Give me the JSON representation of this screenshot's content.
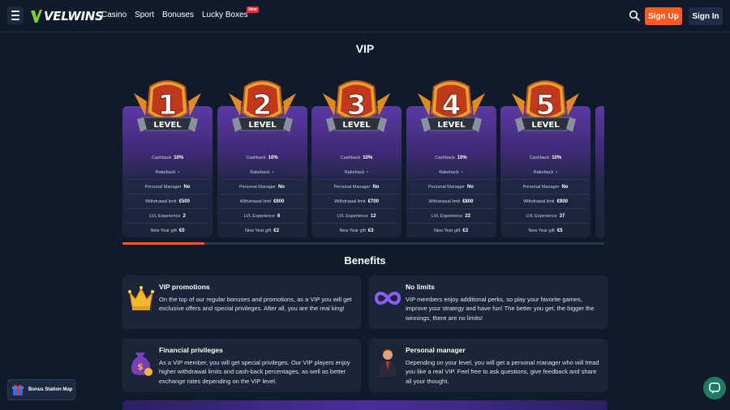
{
  "header": {
    "logo_text": "VELWINS",
    "nav": [
      {
        "label": "Casino"
      },
      {
        "label": "Sport"
      },
      {
        "label": "Bonuses"
      },
      {
        "label": "Lucky Boxes",
        "badge": "New"
      }
    ],
    "signup_label": "Sign Up",
    "signin_label": "Sign In"
  },
  "page_title": "VIP",
  "levels": [
    {
      "number": "1",
      "badge_word": "LEVEL",
      "cashback": "10%",
      "rakeback": "-",
      "manager": "No",
      "withdrawal": "€500",
      "experience": "2",
      "gift": "€0"
    },
    {
      "number": "2",
      "badge_word": "LEVEL",
      "cashback": "10%",
      "rakeback": "-",
      "manager": "No",
      "withdrawal": "€600",
      "experience": "6",
      "gift": "€2"
    },
    {
      "number": "3",
      "badge_word": "LEVEL",
      "cashback": "10%",
      "rakeback": "-",
      "manager": "No",
      "withdrawal": "€700",
      "experience": "12",
      "gift": "€3"
    },
    {
      "number": "4",
      "badge_word": "LEVEL",
      "cashback": "10%",
      "rakeback": "-",
      "manager": "No",
      "withdrawal": "€800",
      "experience": "22",
      "gift": "€3"
    },
    {
      "number": "5",
      "badge_word": "LEVEL",
      "cashback": "10%",
      "rakeback": "-",
      "manager": "No",
      "withdrawal": "€900",
      "experience": "37",
      "gift": "€5"
    }
  ],
  "row_labels": {
    "cashback": "Cashback",
    "rakeback": "Rakeback",
    "manager": "Personal Manager",
    "withdrawal": "Withdrawal limit",
    "experience": "LVL Experience",
    "gift": "New Year gift"
  },
  "levels_scroll_position": 0.17,
  "benefits_title": "Benefits",
  "benefits": [
    {
      "icon": "crown-icon",
      "title": "VIP promotions",
      "text": "On the top of our regular bonuses and promotions, as a VIP you will get exclusive offers and special privileges. After all, you are the real king!"
    },
    {
      "icon": "infinity-icon",
      "title": "No limits",
      "text": "VIP members enjoy additional perks, so play your favorite games, improve your strategy and have fun! The better you get, the bigger the winnings, there are no limits!"
    },
    {
      "icon": "money-bag-icon",
      "title": "Financial privileges",
      "text": "As a VIP member, you will get special privileges. Our VIP players enjoy higher withdrawal limits and cash-back percentages, as well as better exchange rates depending on the VIP level."
    },
    {
      "icon": "manager-icon",
      "title": "Personal manager",
      "text": "Depending on your level, you will get a personal manager who will tread you like a real VIP. Feel free to ask questions, give feedback and share all your thought."
    }
  ],
  "bonus_map_label": "Bonus Station Map",
  "colors": {
    "accent": "#ff5a1f",
    "background": "#0f1a2b",
    "card": "#1a2538",
    "purple": "#5b3aa3"
  }
}
